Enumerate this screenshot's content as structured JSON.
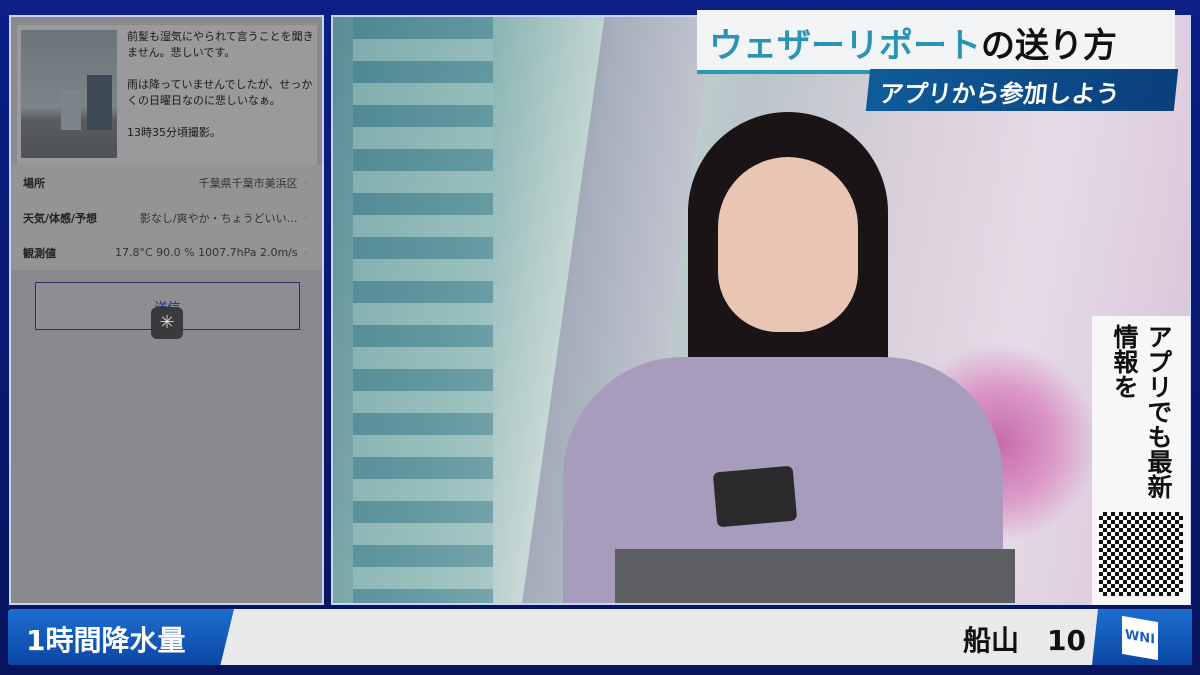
{
  "phone_app": {
    "post_text": [
      "前髪も湿気にやられて言うことを聞きません。悲しいです。",
      "雨は降っていませんでしたが、せっかくの日曜日なのに悲しいなぁ。",
      "13時35分頃撮影。"
    ],
    "rows": [
      {
        "label": "場所",
        "value": "千葉県千葉市美浜区"
      },
      {
        "label": "天気/体感/予想",
        "value": "影なし/爽やか・ちょうどいい…"
      },
      {
        "label": "観測値",
        "value": "17.8°C 90.0 % 1007.7hPa 2.0m/s"
      }
    ],
    "send_label": "送信"
  },
  "overlay": {
    "title_highlight": "ウェザーリポート",
    "title_rest": "の送り方",
    "subtitle": "アプリから参加しよう",
    "side_text": "アプリでも最新情報を"
  },
  "ticker": {
    "label": "1時間降水量",
    "text": "船山　10",
    "logo": "WNI"
  }
}
